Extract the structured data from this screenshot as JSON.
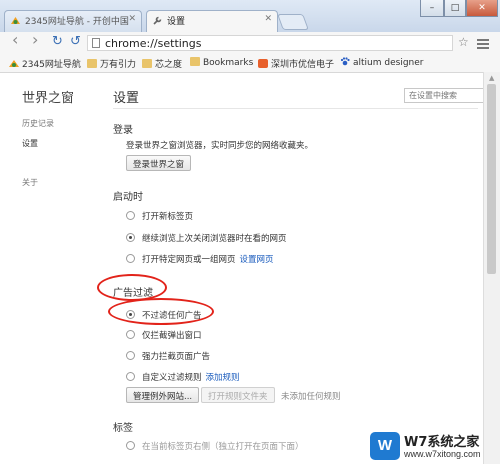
{
  "tabs": [
    {
      "title": "2345网址导航 - 开创中国",
      "icon": "2345-logo-icon",
      "close": "✕"
    },
    {
      "title": "设置",
      "icon": "wrench-icon",
      "close": "✕"
    }
  ],
  "window_controls": {
    "minimize": "–",
    "maximize": "□",
    "close": "✕"
  },
  "toolbar": {
    "back": "‹",
    "forward": "›",
    "reload": "↻",
    "undo": "↺",
    "url": "chrome://settings",
    "star": "☆"
  },
  "bookmarks": [
    {
      "label": "2345网址导航",
      "icon": "2345-logo-icon"
    },
    {
      "label": "万有引力",
      "icon": "folder-icon"
    },
    {
      "label": "芯之度",
      "icon": "folder-icon"
    },
    {
      "label": "Bookmarks",
      "icon": "folder-icon"
    },
    {
      "label": "深圳市优信电子",
      "icon": "shop-icon"
    },
    {
      "label": "altium designer",
      "icon": "paw-icon"
    }
  ],
  "sidebar": {
    "title": "世界之窗",
    "items": [
      "历史记录",
      "设置",
      "关于"
    ]
  },
  "main": {
    "title": "设置",
    "search_placeholder": "在设置中搜索",
    "login": {
      "title": "登录",
      "description": "登录世界之窗浏览器，实时同步您的网络收藏夹。",
      "button": "登录世界之窗"
    },
    "startup": {
      "title": "启动时",
      "options": [
        "打开新标签页",
        "继续浏览上次关闭浏览器时在看的网页",
        "打开特定网页或一组网页"
      ],
      "selected": 1,
      "link": "设置网页"
    },
    "adfilter": {
      "title": "广告过滤",
      "options": [
        "不过滤任何广告",
        "仅拦截弹出窗口",
        "强力拦截页面广告",
        "自定义过滤规则"
      ],
      "selected": 0,
      "link": "添加规则",
      "buttons": [
        "管理例外网站...",
        "打开规则文件夹"
      ],
      "status": "未添加任何规则"
    },
    "tabs_section": {
      "title": "标签",
      "partial": "在当前标签页右侧（独立打开在页面下面）"
    }
  },
  "watermark": {
    "logo": "W",
    "title": "W7系统之家",
    "url": "www.w7xitong.com"
  },
  "colors": {
    "annotation": "#e2231a",
    "link": "#1a5bbd"
  }
}
